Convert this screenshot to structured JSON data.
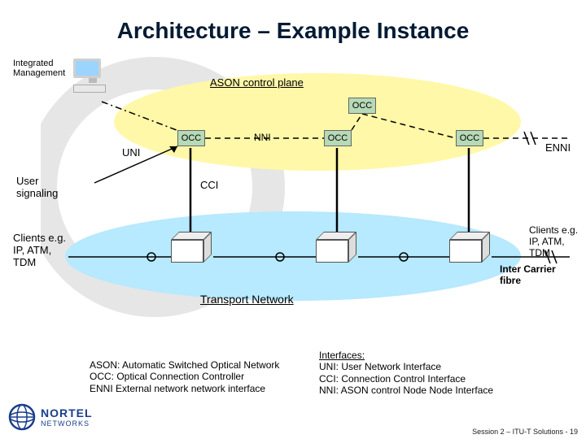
{
  "title": "Architecture – Example Instance",
  "brand": {
    "name": "NORTEL",
    "sub": "NETWORKS"
  },
  "footer": "Session 2 – ITU-T Solutions - 19",
  "labels": {
    "integrated_mgmt": "Integrated Management",
    "ason_plane": "ASON control plane",
    "nni": "NNI",
    "enni": "ENNI",
    "cci": "CCI",
    "user_signaling": "User signaling",
    "uni": "UNI",
    "clients_left": "Clients e.g. IP, ATM, TDM",
    "clients_right": "Clients e.g. IP, ATM, TDM",
    "transport": "Transport Network",
    "inter_carrier": "Inter Carrier fibre",
    "occ": "OCC"
  },
  "legend": {
    "l1": "ASON: Automatic Switched Optical Network",
    "l2": "OCC: Optical Connection Controller",
    "l3": "ENNI External network network interface"
  },
  "interfaces": {
    "title": "Interfaces:",
    "i1": "UNI: User Network Interface",
    "i2": "CCI: Connection Control Interface",
    "i3": "NNI: ASON control Node Node Interface"
  }
}
